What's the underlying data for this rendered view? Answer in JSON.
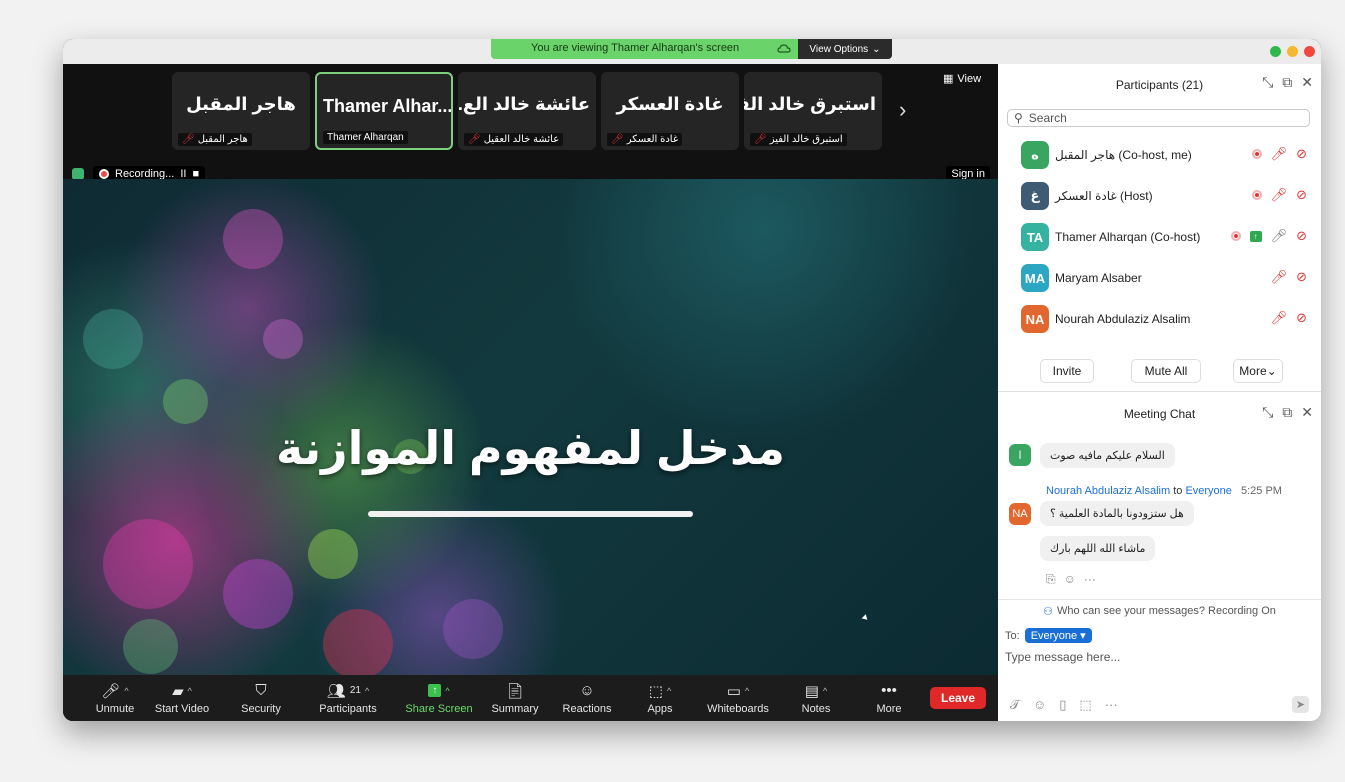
{
  "banner": {
    "text": "You are viewing Thamer Alharqan's screen",
    "view_options": "View Options"
  },
  "thumbnails": [
    {
      "name": "هاجر المقبل",
      "sub": "هاجر المقبل",
      "muted": true,
      "active": false
    },
    {
      "name": "Thamer Alhar...",
      "sub": "Thamer Alharqan",
      "muted": false,
      "active": true
    },
    {
      "name": "عائشة خالد الع...",
      "sub": "عائشة خالد العقيل",
      "muted": true,
      "active": false
    },
    {
      "name": "غادة العسكر",
      "sub": "غادة العسكر",
      "muted": true,
      "active": false
    },
    {
      "name": "استبرق خالد الفيز",
      "sub": "استبرق خالد الفيز",
      "muted": true,
      "active": false
    }
  ],
  "view_button": "View",
  "recording": {
    "label": "Recording...",
    "pause": "II",
    "stop": "■"
  },
  "sign_in": "Sign in",
  "slide": {
    "title": "مدخل لمفهوم الموازنة"
  },
  "toolbar": {
    "unmute": "Unmute",
    "start_video": "Start Video",
    "security": "Security",
    "participants": "Participants",
    "participants_count": "21",
    "share_screen": "Share Screen",
    "summary": "Summary",
    "reactions": "Reactions",
    "apps": "Apps",
    "whiteboards": "Whiteboards",
    "notes": "Notes",
    "more": "More",
    "leave": "Leave"
  },
  "participants_panel": {
    "title": "Participants (21)",
    "search_placeholder": "Search",
    "list": [
      {
        "initials": "ه",
        "name": "هاجر المقبل (Co-host, me)",
        "color": "#3aa561",
        "recording": true,
        "sharing": false,
        "mic_muted": true
      },
      {
        "initials": "غ",
        "name": "غادة العسكر (Host)",
        "color": "#3f5a73",
        "recording": true,
        "sharing": false,
        "mic_muted": true
      },
      {
        "initials": "TA",
        "name": "Thamer Alharqan (Co-host)",
        "color": "#36b3a0",
        "recording": true,
        "sharing": true,
        "mic_muted": false
      },
      {
        "initials": "MA",
        "name": "Maryam Alsaber",
        "color": "#2ba7c4",
        "recording": false,
        "sharing": false,
        "mic_muted": true
      },
      {
        "initials": "NA",
        "name": "Nourah Abdulaziz Alsalim",
        "color": "#e2672f",
        "recording": false,
        "sharing": false,
        "mic_muted": true
      }
    ],
    "invite": "Invite",
    "mute_all": "Mute All",
    "more": "More"
  },
  "chat": {
    "title": "Meeting Chat",
    "first_avatar": "ا",
    "msg1": "السلام عليكم مافيه صوت",
    "sender_name": "Nourah Abdulaziz Alsalim",
    "sender_to": "to",
    "sender_target": "Everyone",
    "sender_time": "5:25 PM",
    "sender_initials": "NA",
    "msg2": "هل ستزودونا بالمادة العلمية ؟",
    "msg3": "ماشاء الله اللهم بارك",
    "who_can_see": "Who can see your messages? Recording On",
    "to_label": "To:",
    "to_value": "Everyone",
    "placeholder": "Type message here..."
  }
}
